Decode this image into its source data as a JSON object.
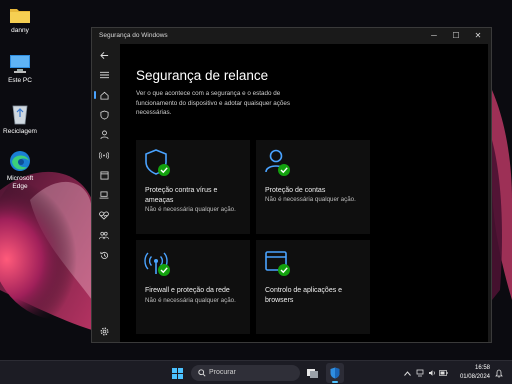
{
  "desktop": {
    "icons": [
      {
        "label": "danny",
        "icon": "folder-icon"
      },
      {
        "label": "Este PC",
        "icon": "computer-icon"
      },
      {
        "label": "Reciclagem",
        "icon": "recycle-bin-icon"
      },
      {
        "label": "Microsoft Edge",
        "icon": "edge-icon"
      }
    ]
  },
  "window": {
    "title": "Segurança do Windows",
    "controls": {
      "minimize": "─",
      "maximize": "☐",
      "close": "✕"
    }
  },
  "sidebar": {
    "items": [
      {
        "name": "back",
        "icon": "back-arrow-icon"
      },
      {
        "name": "menu",
        "icon": "hamburger-menu-icon"
      },
      {
        "name": "home",
        "icon": "home-icon",
        "active": true
      },
      {
        "name": "virus-protection",
        "icon": "shield-icon"
      },
      {
        "name": "account-protection",
        "icon": "person-icon"
      },
      {
        "name": "firewall",
        "icon": "antenna-icon"
      },
      {
        "name": "app-browser-control",
        "icon": "browser-window-icon"
      },
      {
        "name": "device-security",
        "icon": "laptop-icon"
      },
      {
        "name": "device-performance",
        "icon": "heart-pulse-icon"
      },
      {
        "name": "family-options",
        "icon": "family-icon"
      },
      {
        "name": "protection-history",
        "icon": "history-icon"
      },
      {
        "name": "settings",
        "icon": "gear-icon"
      }
    ]
  },
  "main": {
    "title": "Segurança de relance",
    "description": "Ver o que acontece com a segurança e o estado de funcionamento do dispositivo e adotar quaisquer ações necessárias.",
    "cards": [
      {
        "title": "Proteção contra vírus e ameaças",
        "status": "Não é necessária qualquer ação.",
        "icon": "shield-check-icon"
      },
      {
        "title": "Proteção de contas",
        "status": "Não é necessária qualquer ação.",
        "icon": "person-check-icon"
      },
      {
        "title": "Firewall e proteção da rede",
        "status": "Não é necessária qualquer ação.",
        "icon": "antenna-check-icon"
      },
      {
        "title": "Controlo de aplicações e browsers",
        "status": "",
        "icon": "browser-check-icon"
      }
    ]
  },
  "taskbar": {
    "search_placeholder": "Procurar",
    "time": "16:58",
    "date": "01/08/2024"
  },
  "colors": {
    "accent": "#4aa3ff",
    "ok_badge": "#13a10e",
    "window_bg": "#1a1a1a",
    "content_bg": "#000000"
  }
}
